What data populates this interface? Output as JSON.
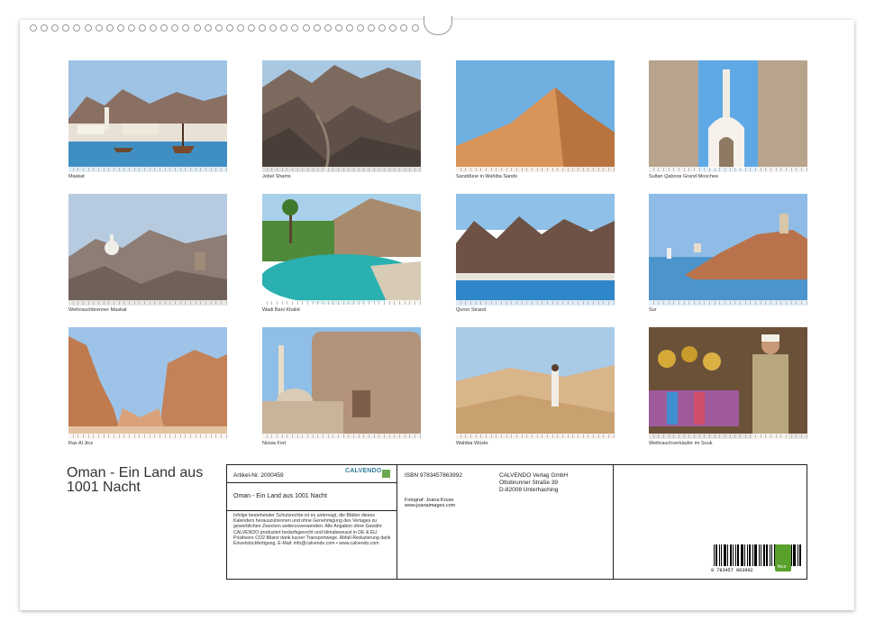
{
  "title_line1": "Oman - Ein Land aus",
  "title_line2": "1001 Nacht",
  "photos": [
    {
      "caption": "Maskat"
    },
    {
      "caption": "Jebel Shams"
    },
    {
      "caption": "Sanddüne in Wahiba Sands"
    },
    {
      "caption": "Sultan Qaboos Grand Moschee"
    },
    {
      "caption": "Weihrauchbrenner Maskat"
    },
    {
      "caption": "Wadi Bani Khalid"
    },
    {
      "caption": "Quron Strand"
    },
    {
      "caption": "Sur"
    },
    {
      "caption": "Ras Al Jinz"
    },
    {
      "caption": "Nizwa Fort"
    },
    {
      "caption": "Wahiba Wüste"
    },
    {
      "caption": "Weihrauchverkäufer im Souk"
    }
  ],
  "info": {
    "artikel": "Artikel-Nr. 2000459",
    "calvendo": "CALVENDO",
    "product_title": "Oman - Ein Land aus 1001 Nacht",
    "isbn": "ISBN 9783457863992",
    "publisher_name": "CALVENDO Verlag GmbH",
    "publisher_street": "Ottobrunner Straße 39",
    "publisher_city": "D-82008 Unterhaching",
    "photographer": "Fotograf: Joana Kruse",
    "website": "www.joanaimages.com",
    "legal": "Infolge bestehender Schutzrechte ist es untersagt, die Blätter dieses Kalenders herauszutrennen und ohne Genehmigung des Verlages zu gewerblichen Zwecken weiterzuverwenden. Alle Angaben ohne Gewähr. CALVENDO produziert bedarfsgerecht und klimabewusst in DE & EU. Positivere CO2-Bilanz dank kurzer Transportwege. Abfall-Reduzierung dank Einzelstückfertigung. E-Mail: info@calvendo.com • www.calvendo.com",
    "barcode_digits": "9 783457 863992",
    "feco": "feco"
  }
}
